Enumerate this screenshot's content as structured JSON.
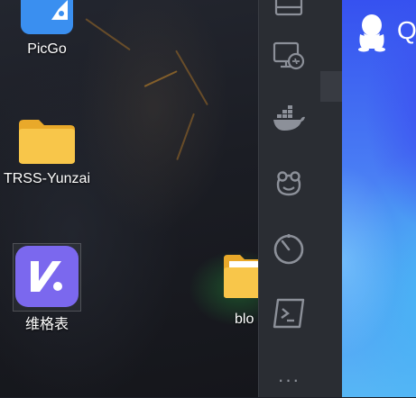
{
  "desktop": {
    "icons": [
      {
        "label": "PicGo",
        "icon": "picgo-icon"
      },
      {
        "label": "TRSS-Yunzai",
        "icon": "folder-icon"
      },
      {
        "label": "维格表",
        "icon": "vika-icon"
      },
      {
        "label": "blo",
        "icon": "folder-icon"
      }
    ]
  },
  "dock": {
    "items": [
      {
        "name": "remote-desktop",
        "icon": "remote-desktop-icon"
      },
      {
        "name": "docker",
        "icon": "docker-icon"
      },
      {
        "name": "frog-app",
        "icon": "frog-icon"
      },
      {
        "name": "timer",
        "icon": "timer-icon"
      },
      {
        "name": "terminal",
        "icon": "terminal-icon"
      }
    ],
    "more_glyph": "···"
  },
  "qq": {
    "title": "Q",
    "icon": "qq-penguin-icon",
    "accent": "#3b4ef0"
  },
  "colors": {
    "panel": "#2a2d33",
    "icon_stroke": "#8c9099",
    "folder": "#f8c64a",
    "vika": "#7b68ee",
    "picgo": "#3a8ff0"
  }
}
